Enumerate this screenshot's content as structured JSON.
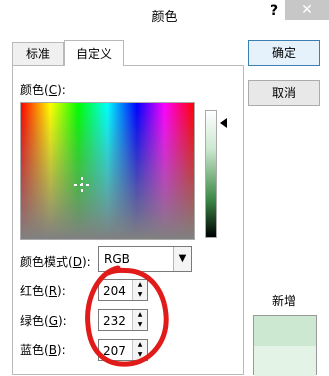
{
  "dialog": {
    "title": "颜色",
    "help_label": "?",
    "close_label": "✕"
  },
  "tabs": [
    {
      "label": "标准"
    },
    {
      "label": "自定义"
    }
  ],
  "custom": {
    "colors_label": "颜色(",
    "colors_key": "C",
    "colors_tail": "):",
    "mode_label": "颜色模式(",
    "mode_key": "D",
    "mode_tail": "):",
    "mode_value": "RGB",
    "red_label": "红色(",
    "red_key": "R",
    "red_tail": "):",
    "red_value": "204",
    "green_label": "绿色(",
    "green_key": "G",
    "green_tail": "):",
    "green_value": "232",
    "blue_label": "蓝色(",
    "blue_key": "B",
    "blue_tail": "):",
    "blue_value": "207"
  },
  "buttons": {
    "ok": "确定",
    "cancel": "取消"
  },
  "preview": {
    "new_label": "新增",
    "new_color": "#cce8d0"
  },
  "annotation": {
    "color": "#e11a1a"
  }
}
